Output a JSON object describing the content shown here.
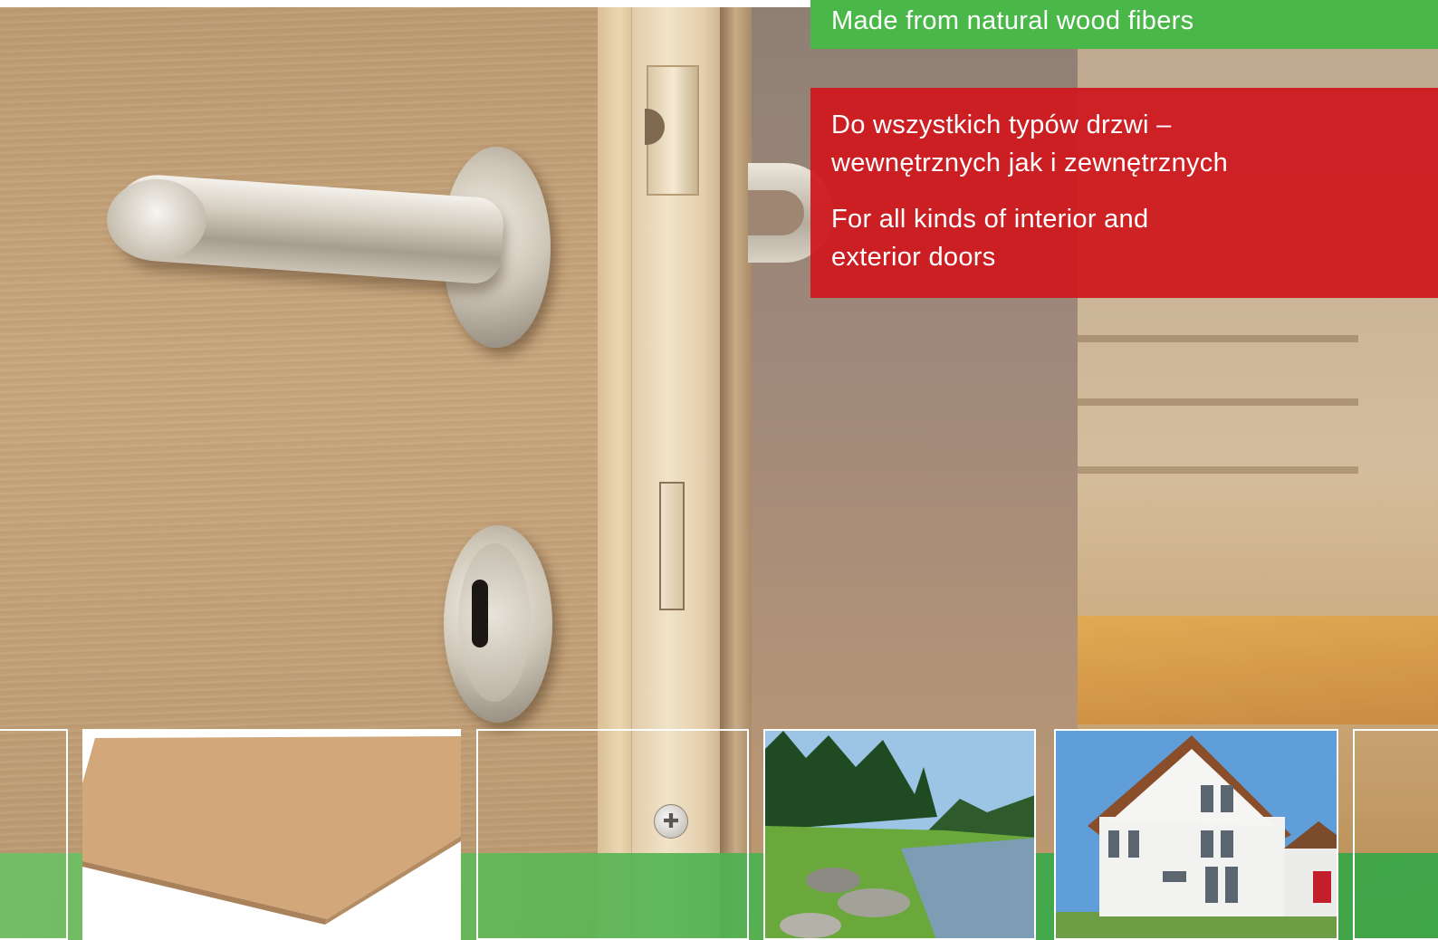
{
  "banners": {
    "green_text": "Made from natural wood fibers",
    "red_line1": "Do wszystkich typów drzwi –",
    "red_line2": "wewnętrznych jak i zewnętrznych",
    "red_line3": "For all kinds of interior and",
    "red_line4": "exterior doors"
  },
  "colors": {
    "green": "#49b848",
    "red": "#ce181e"
  },
  "thumbnails": [
    "door-detail-crop",
    "fiberboard-sheet",
    "door-edge-crop",
    "forest-river-landscape",
    "white-house",
    "door-detail-crop"
  ]
}
